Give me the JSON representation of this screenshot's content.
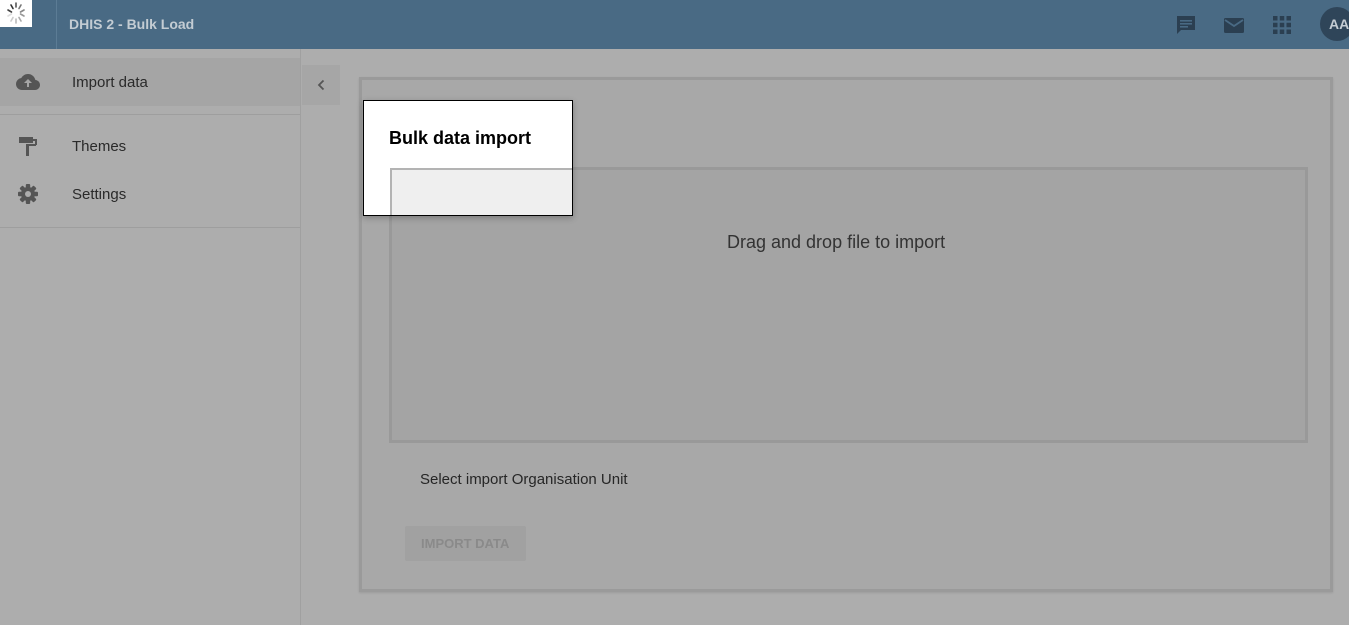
{
  "header": {
    "logo_icon": "loading-spinner-icon",
    "app_title": "DHIS 2 - Bulk Load",
    "icons": [
      "chat-icon",
      "mail-icon",
      "apps-grid-icon"
    ],
    "avatar_initials": "AA",
    "background_color": "#496a84"
  },
  "sidebar": {
    "items": [
      {
        "label": "Import data",
        "icon": "cloud-upload-icon",
        "active": true
      },
      {
        "label": "Themes",
        "icon": "paint-roller-icon",
        "active": false
      },
      {
        "label": "Settings",
        "icon": "gear-icon",
        "active": false
      }
    ],
    "collapse_icon": "chevron-left-icon"
  },
  "main": {
    "dropzone_text": "Drag and drop file to import",
    "org_unit_label": "Select import Organisation Unit",
    "import_button_label": "IMPORT DATA"
  },
  "tour": {
    "title": "Bulk data import"
  }
}
